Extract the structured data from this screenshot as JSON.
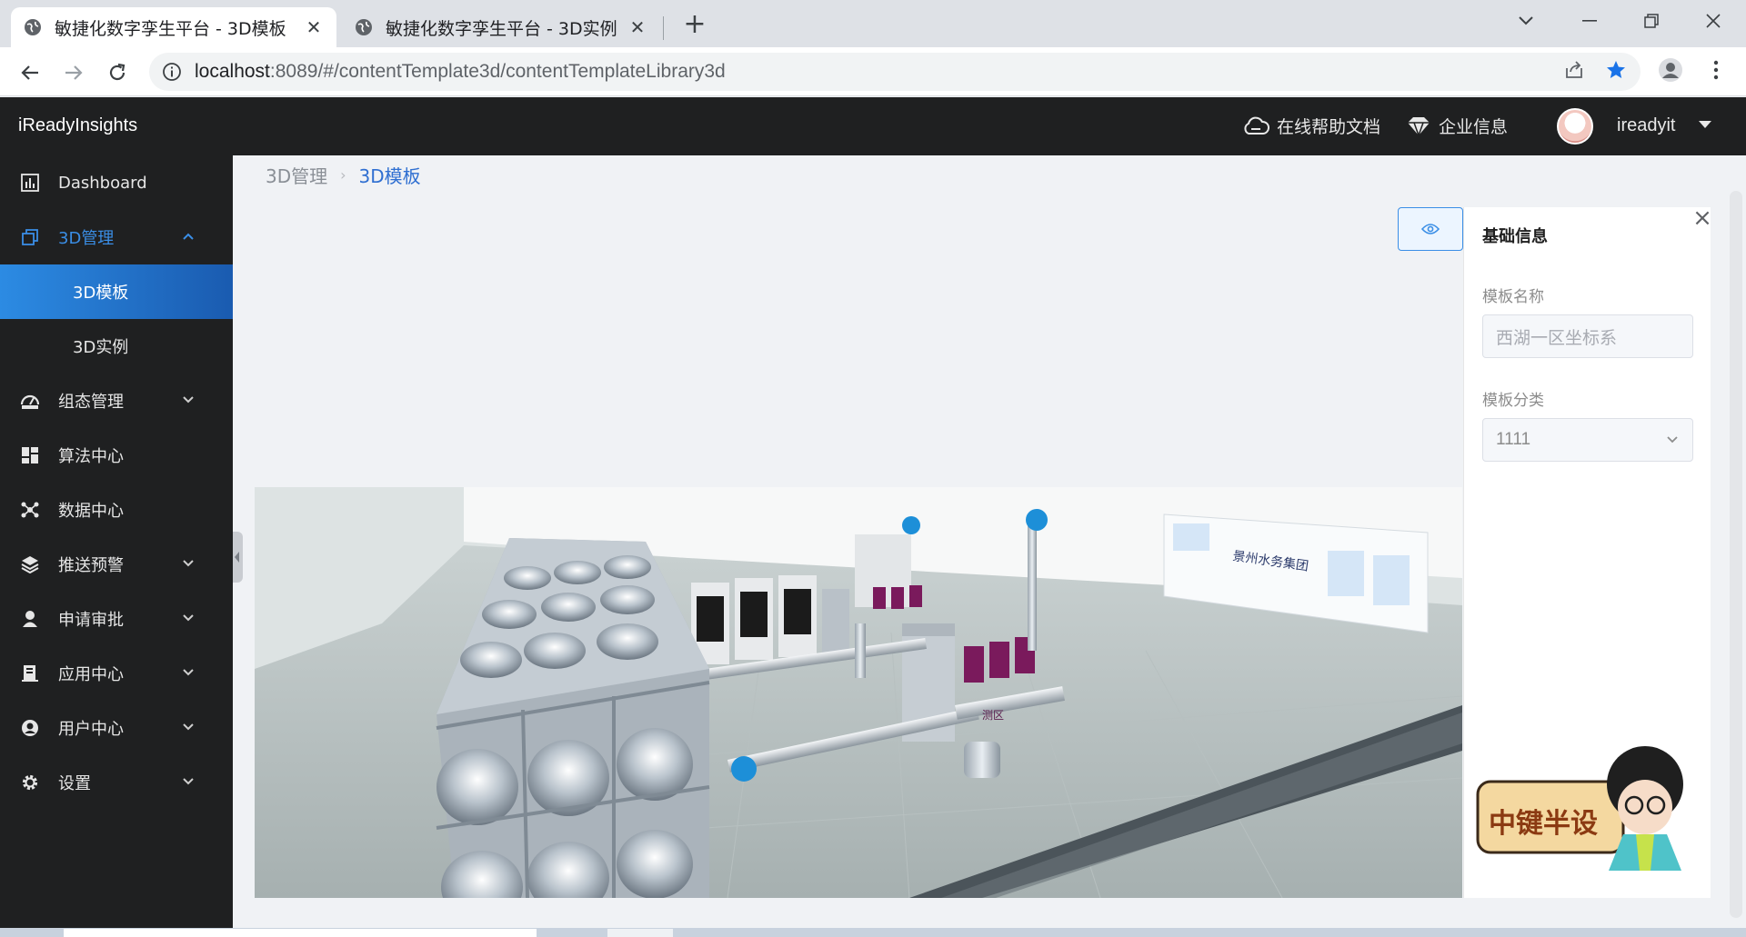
{
  "browser": {
    "tabs": [
      {
        "title": "敏捷化数字孪生平台 - 3D模板",
        "active": true
      },
      {
        "title": "敏捷化数字孪生平台 - 3D实例",
        "active": false
      }
    ],
    "new_tab_label": "+",
    "url_host": "localhost",
    "url_rest": ":8089/#/contentTemplate3d/contentTemplateLibrary3d"
  },
  "header": {
    "brand": "iReadyInsights",
    "help_docs": "在线帮助文档",
    "company_info": "企业信息",
    "username": "ireadyit"
  },
  "sidebar": {
    "items": [
      {
        "label": "Dashboard",
        "icon": "bar-chart-icon"
      },
      {
        "label": "3D管理",
        "icon": "cube-icon",
        "expanded": true
      },
      {
        "label": "3D模板",
        "sub": true,
        "active": true
      },
      {
        "label": "3D实例",
        "sub": true
      },
      {
        "label": "组态管理",
        "icon": "dashboard-icon"
      },
      {
        "label": "算法中心",
        "icon": "grid-icon"
      },
      {
        "label": "数据中心",
        "icon": "hub-icon"
      },
      {
        "label": "推送预警",
        "icon": "layers-icon"
      },
      {
        "label": "申请审批",
        "icon": "person-icon"
      },
      {
        "label": "应用中心",
        "icon": "app-icon"
      },
      {
        "label": "用户中心",
        "icon": "user-circle-icon"
      },
      {
        "label": "设置",
        "icon": "gear-icon"
      }
    ]
  },
  "breadcrumb": {
    "parent": "3D管理",
    "separator": "›",
    "current": "3D模板"
  },
  "panel": {
    "title": "基础信息",
    "close": "×",
    "name_label": "模板名称",
    "name_placeholder": "西湖一区坐标系",
    "category_label": "模板分类",
    "category_value": "1111"
  },
  "scene": {
    "board_title": "景州水务集团",
    "area_label": "测区"
  },
  "mascot": {
    "text": "中键半设"
  },
  "colors": {
    "accent": "#3a8ee6",
    "sidebar_bg": "#1f2021",
    "active_item": "#2c8be3"
  }
}
